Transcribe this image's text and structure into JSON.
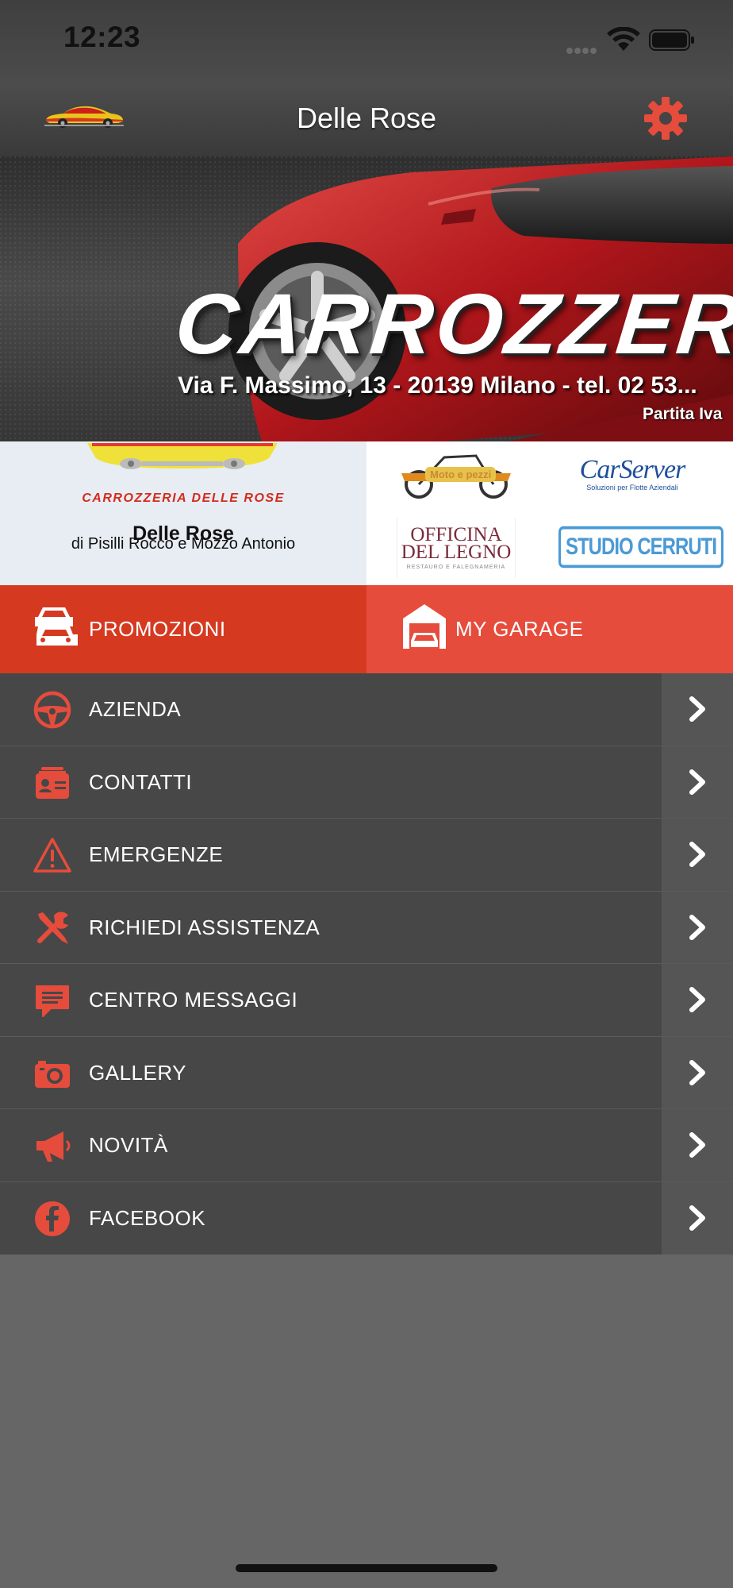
{
  "status_bar": {
    "time": "12:23"
  },
  "header": {
    "title": "Delle Rose"
  },
  "banner": {
    "brand": "CARROZZERIA",
    "address": "Via F. Massimo, 13 - 20139 Milano - tel. 02 53...",
    "vat": "Partita Iva"
  },
  "company": {
    "logo_text": "CARROZZERIA DELLE ROSE",
    "name": "Delle Rose",
    "subtitle": "di Pisilli Rocco e Mozzo Antonio"
  },
  "sponsors": {
    "moto": "Moto e pezzi",
    "carserver": "CarServer",
    "carserver_sub": "Soluzioni per Flotte Aziendali",
    "officina_line1": "OFFICINA",
    "officina_line2": "DEL LEGNO",
    "officina_sub": "RESTAURO E FALEGNAMERIA",
    "cerruti": "STUDIO CERRUTI"
  },
  "actions": [
    {
      "label": "PROMOZIONI"
    },
    {
      "label": "MY GARAGE"
    }
  ],
  "menu": [
    {
      "label": "AZIENDA",
      "icon": "steering-wheel-icon"
    },
    {
      "label": "CONTATTI",
      "icon": "contact-card-icon"
    },
    {
      "label": "EMERGENZE",
      "icon": "warning-icon"
    },
    {
      "label": "RICHIEDI ASSISTENZA",
      "icon": "tools-icon"
    },
    {
      "label": "CENTRO MESSAGGI",
      "icon": "message-icon"
    },
    {
      "label": "GALLERY",
      "icon": "camera-icon"
    },
    {
      "label": "NOVITÀ",
      "icon": "megaphone-icon"
    },
    {
      "label": "FACEBOOK",
      "icon": "facebook-icon"
    }
  ],
  "colors": {
    "accent": "#e64c3c",
    "promo": "#d53a21",
    "menu_bg": "#474747",
    "background": "#666666"
  }
}
